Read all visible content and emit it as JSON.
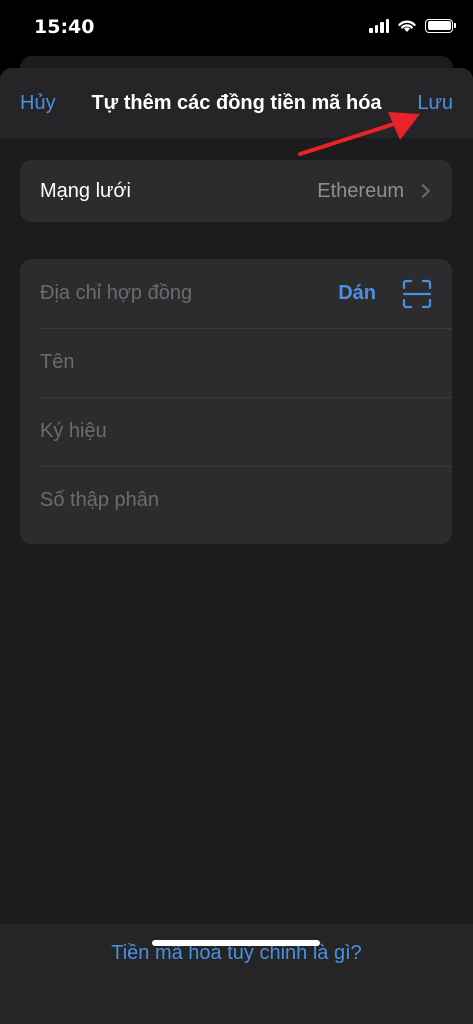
{
  "status_bar": {
    "time": "15:40",
    "icons": [
      "signal-icon",
      "wifi-icon",
      "battery-icon"
    ]
  },
  "nav": {
    "cancel_label": "Hủy",
    "title": "Tự thêm các đồng tiền mã hóa",
    "save_label": "Lưu"
  },
  "network": {
    "label": "Mạng lưới",
    "value": "Ethereum"
  },
  "form": {
    "contract_address_placeholder": "Địa chỉ hợp đồng",
    "paste_label": "Dán",
    "name_placeholder": "Tên",
    "symbol_placeholder": "Ký hiệu",
    "decimals_placeholder": "Số thập phân"
  },
  "footer": {
    "help_link": "Tiền mã hoá tuỳ chỉnh là gì?"
  },
  "colors": {
    "accent": "#4a90e2",
    "background": "#1c1c1e",
    "card": "#2c2c2e",
    "annotation_arrow": "#e8232a"
  }
}
